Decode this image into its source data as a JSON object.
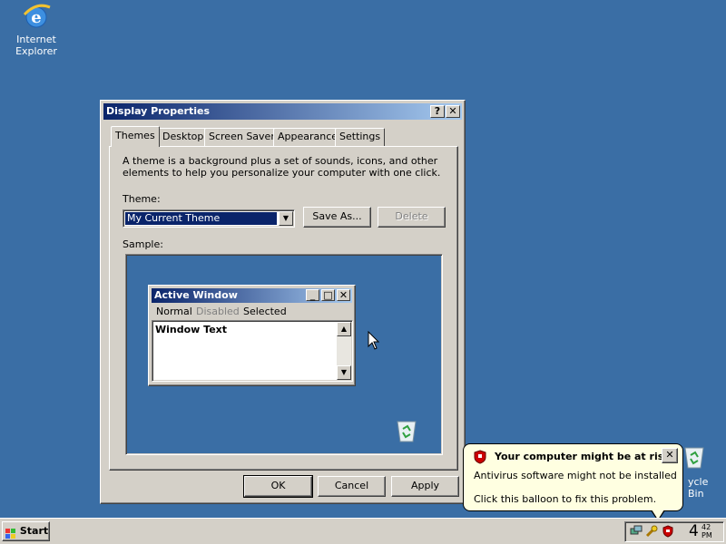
{
  "desktop": {
    "ie_label_line1": "Internet",
    "ie_label_line2": "Explorer",
    "recycle_label": "ycle Bin"
  },
  "dialog": {
    "title": "Display Properties",
    "help_btn": "?",
    "close_btn": "✕",
    "tabs": [
      "Themes",
      "Desktop",
      "Screen Saver",
      "Appearance",
      "Settings"
    ],
    "description": "A theme is a background plus a set of sounds, icons, and other elements to help you personalize your computer with one click.",
    "theme_label": "Theme:",
    "theme_value": "My Current Theme",
    "save_as_label": "Save As...",
    "delete_label": "Delete",
    "sample_label": "Sample:",
    "ok_label": "OK",
    "cancel_label": "Cancel",
    "apply_label": "Apply"
  },
  "sample_window": {
    "title": "Active Window",
    "menu": [
      "Normal",
      "Disabled",
      "Selected"
    ],
    "body_text": "Window Text"
  },
  "balloon": {
    "title": "Your computer might be at risk",
    "line1": "Antivirus software might not be installed",
    "line2": "Click this balloon to fix this problem.",
    "close": "✕"
  },
  "taskbar": {
    "start_label": "Start",
    "clock_hour": "4",
    "clock_min": "42",
    "clock_ampm": "PM"
  },
  "colors": {
    "desktop_bg": "#3a6ea5",
    "title_active": "#0a246a",
    "face": "#d4d0c8",
    "balloon_bg": "#ffffe1"
  }
}
